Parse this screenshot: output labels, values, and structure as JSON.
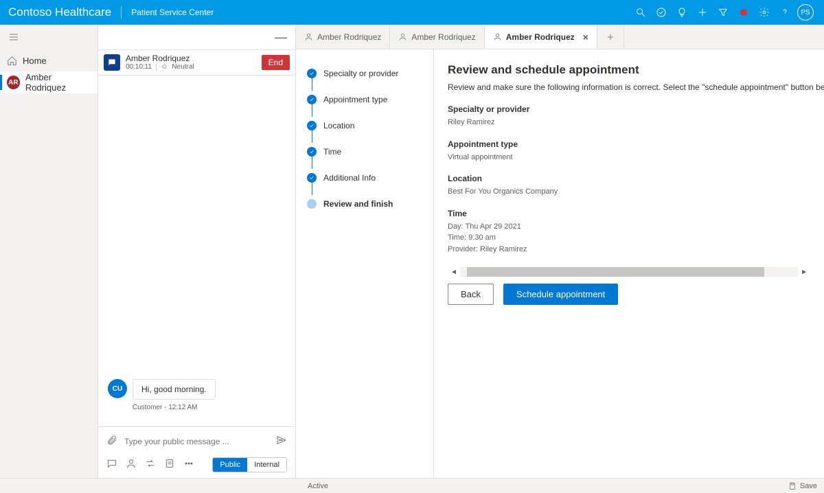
{
  "header": {
    "brand": "Contoso Healthcare",
    "sub": "Patient Service Center",
    "avatar_initials": "PS"
  },
  "nav": {
    "home": "Home",
    "active": {
      "initials": "AR",
      "name": "Amber Rodriquez"
    }
  },
  "conversation": {
    "name": "Amber Rodriquez",
    "timer": "00:10:11",
    "sentiment": "Neutral",
    "end_label": "End",
    "message": {
      "avatar": "CU",
      "text": "Hi, good morning."
    },
    "message_meta": "Customer - 12:12 AM",
    "composer_placeholder": "Type your public message ...",
    "pill_public": "Public",
    "pill_internal": "Internal"
  },
  "tabs": [
    {
      "label": "Amber Rodriquez",
      "active": false
    },
    {
      "label": "Amber Rodriquez",
      "active": false
    },
    {
      "label": "Amber Rodriquez",
      "active": true
    }
  ],
  "steps": [
    "Specialty or provider",
    "Appointment type",
    "Location",
    "Time",
    "Additional Info",
    "Review and finish"
  ],
  "review": {
    "title": "Review and schedule appointment",
    "hint": "Review and make sure the following information is correct. Select the \"schedule appointment\" button below to book the ap",
    "specialty_label": "Specialty or provider",
    "specialty_value": "Riley Ramirez",
    "type_label": "Appointment type",
    "type_value": "Virtual appointment",
    "location_label": "Location",
    "location_value": "Best For You Organics Company",
    "time_label": "Time",
    "time_day": "Day: Thu Apr 29 2021",
    "time_time": "Time: 9:30 am",
    "time_provider": "Provider: Riley Ramirez",
    "back_label": "Back",
    "schedule_label": "Schedule appointment"
  },
  "status": {
    "active": "Active",
    "save": "Save"
  }
}
